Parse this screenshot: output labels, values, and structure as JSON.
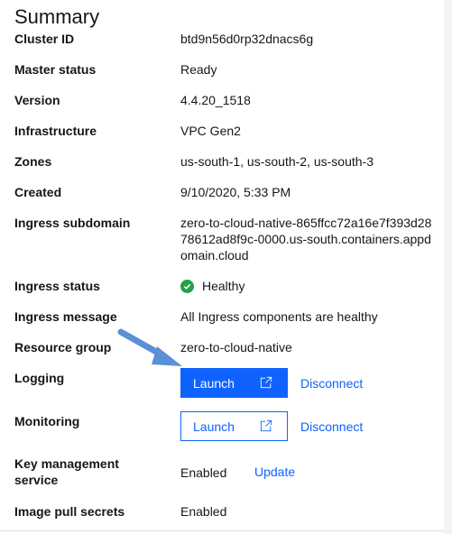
{
  "summary": {
    "title": "Summary",
    "cluster_id": {
      "label": "Cluster ID",
      "value": "btd9n56d0rp32dnacs6g"
    },
    "master_status": {
      "label": "Master status",
      "value": "Ready"
    },
    "version": {
      "label": "Version",
      "value": "4.4.20_1518"
    },
    "infrastructure": {
      "label": "Infrastructure",
      "value": "VPC Gen2"
    },
    "zones": {
      "label": "Zones",
      "value": "us-south-1, us-south-2, us-south-3"
    },
    "created": {
      "label": "Created",
      "value": "9/10/2020, 5:33 PM"
    },
    "ingress_subdomain": {
      "label": "Ingress subdomain",
      "value": "zero-to-cloud-native-865ffcc72a16e7f393d2878612ad8f9c-0000.us-south.containers.appdomain.cloud"
    },
    "ingress_status": {
      "label": "Ingress status",
      "value": "Healthy",
      "status_color": "#24a148"
    },
    "ingress_message": {
      "label": "Ingress message",
      "value": "All Ingress components are healthy"
    },
    "resource_group": {
      "label": "Resource group",
      "value": "zero-to-cloud-native"
    },
    "logging": {
      "label": "Logging",
      "launch_label": "Launch",
      "disconnect_label": "Disconnect"
    },
    "monitoring": {
      "label": "Monitoring",
      "launch_label": "Launch",
      "disconnect_label": "Disconnect"
    },
    "key_management": {
      "label_line1": "Key management",
      "label_line2": "service",
      "value": "Enabled",
      "update_label": "Update"
    },
    "image_pull_secrets": {
      "label": "Image pull secrets",
      "value": "Enabled"
    }
  },
  "icons": {
    "launch": "external-link-icon",
    "status": "checkmark-filled-icon",
    "annotation": "arrow-icon"
  },
  "colors": {
    "accent": "#0f62fe",
    "success": "#24a148",
    "arrow": "#5b8fd6"
  }
}
